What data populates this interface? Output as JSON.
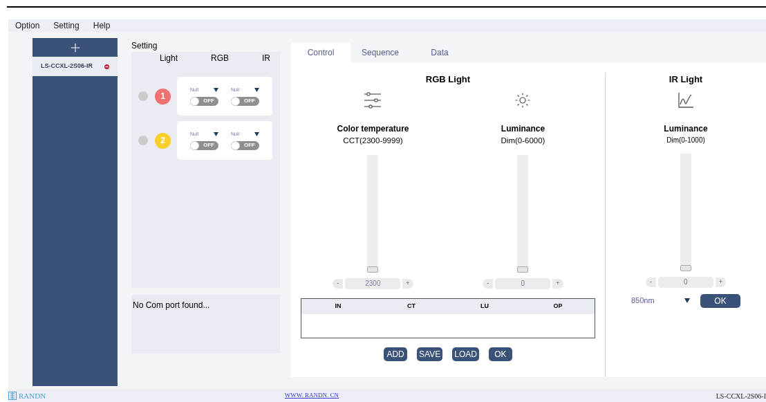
{
  "menu": [
    "Option",
    "Setting",
    "Help"
  ],
  "devices": {
    "items": [
      {
        "label": "LS-CCXL-2S06-IR",
        "selected": true
      }
    ]
  },
  "setting": {
    "title": "Setting",
    "columns": [
      "Light",
      "RGB",
      "IR"
    ],
    "lights": [
      {
        "number": "1",
        "color": "#f07171",
        "on": false,
        "channels": [
          {
            "value": "Null",
            "switch": "OFF",
            "on": false
          },
          {
            "value": "Null",
            "switch": "OFF",
            "on": false
          }
        ]
      },
      {
        "number": "2",
        "color": "#f9cf2c",
        "on": false,
        "channels": [
          {
            "value": "Null",
            "switch": "OFF",
            "on": false
          },
          {
            "value": "Null",
            "switch": "OFF",
            "on": false
          }
        ]
      }
    ]
  },
  "log": "No Com port found...",
  "tabs": [
    {
      "label": "Control",
      "selected": true
    },
    {
      "label": "Sequence",
      "selected": false
    },
    {
      "label": "Data",
      "selected": false
    }
  ],
  "rgb": {
    "title": "RGB Light",
    "controls": [
      {
        "kind": "temperature",
        "title": "Color temperature",
        "range": "CCT(2300-9999)",
        "level": 0,
        "value": "2300",
        "minus": "-",
        "plus": "+"
      },
      {
        "kind": "luminance",
        "title": "Luminance",
        "range": "Dim(0-6000)",
        "level": 0,
        "value": "0",
        "minus": "-",
        "plus": "+"
      }
    ],
    "table": {
      "columns": [
        "IN",
        "CT",
        "LU",
        "OP"
      ]
    },
    "buttons": [
      "ADD",
      "SAVE",
      "LOAD",
      "OK"
    ]
  },
  "ir": {
    "title": "IR Light",
    "control": {
      "kind": "curve",
      "title": "Luminance",
      "range": "Dim(0-1000)",
      "level": 0,
      "value": "0",
      "minus": "-",
      "plus": "+"
    },
    "wavelength": "850nm",
    "button": "OK"
  },
  "footer": {
    "brand": "RANDN",
    "link": "WWW. RANDN. CN",
    "code": "LS-CCXL-2S06-I"
  }
}
